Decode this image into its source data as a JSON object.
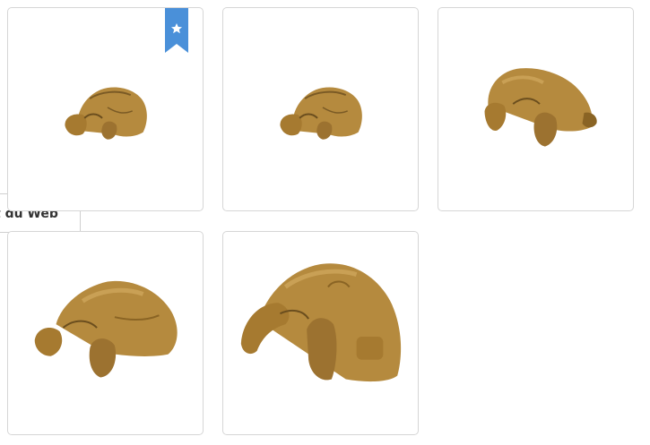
{
  "side_panel": {
    "label": "t du Web"
  },
  "colors": {
    "rock_base": "#b58a3e",
    "rock_light": "#c9a055",
    "rock_dark": "#7a5a25",
    "badge": "#4a90d9",
    "card_border": "#d6d6d6"
  },
  "images": [
    {
      "icon": "small-cave-rock-image",
      "favorite": true
    },
    {
      "icon": "small-cave-rock-image",
      "favorite": false
    },
    {
      "icon": "medium-cave-rock-image",
      "favorite": false
    },
    {
      "icon": "large-cave-rock-image",
      "favorite": false
    },
    {
      "icon": "extra-large-cave-rock-image",
      "favorite": false
    }
  ]
}
